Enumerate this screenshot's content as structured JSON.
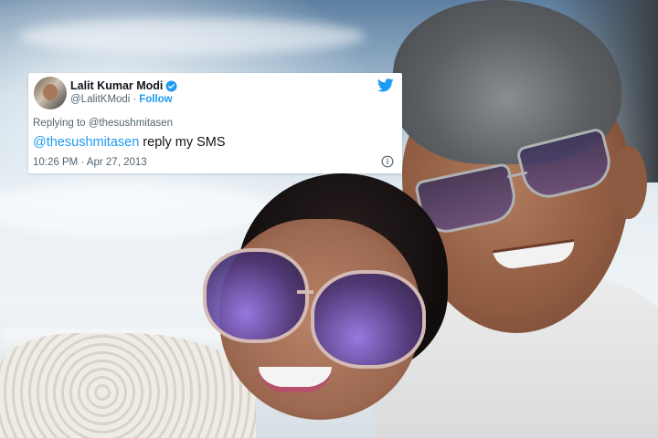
{
  "tweet": {
    "display_name": "Lalit Kumar Modi",
    "handle": "@LalitKModi",
    "separator": "·",
    "follow_label": "Follow",
    "replying_prefix": "Replying to",
    "replying_to": "@thesushmitasen",
    "body_mention": "@thesushmitasen",
    "body_text": " reply my SMS",
    "timestamp": "10:26 PM · Apr 27, 2013",
    "icons": {
      "verified": "verified-badge-icon",
      "brand": "twitter-bird-icon",
      "info": "info-icon"
    },
    "colors": {
      "accent": "#1d9bf0",
      "text": "#0f1419",
      "muted": "#536471"
    }
  }
}
